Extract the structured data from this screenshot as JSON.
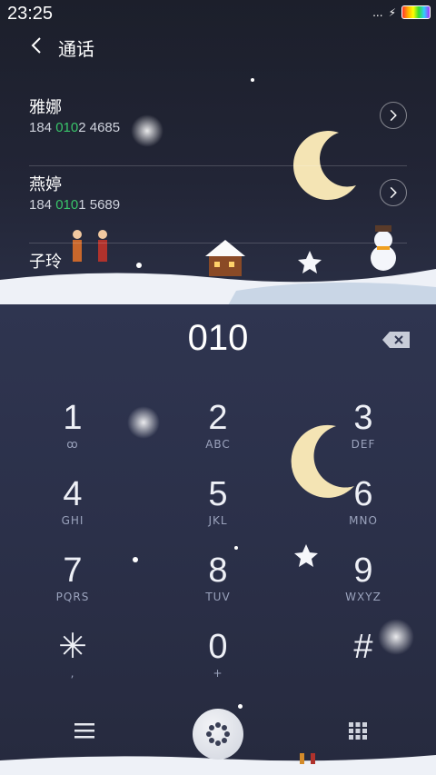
{
  "status": {
    "time": "23:25",
    "signal_dots": "...",
    "charging": "⚡"
  },
  "header": {
    "title": "通话"
  },
  "contacts": [
    {
      "name": "雅娜",
      "num_pre": "184 ",
      "num_hl": "010",
      "num_post": "2 4685"
    },
    {
      "name": "燕婷",
      "num_pre": "184 ",
      "num_hl": "010",
      "num_post": "1 5689"
    },
    {
      "name": "子玲"
    }
  ],
  "dialer": {
    "input": "010"
  },
  "keys": [
    {
      "digit": "1",
      "letters": "ꝏ"
    },
    {
      "digit": "2",
      "letters": "ABC"
    },
    {
      "digit": "3",
      "letters": "DEF"
    },
    {
      "digit": "4",
      "letters": "GHI"
    },
    {
      "digit": "5",
      "letters": "JKL"
    },
    {
      "digit": "6",
      "letters": "MNO"
    },
    {
      "digit": "7",
      "letters": "PQRS"
    },
    {
      "digit": "8",
      "letters": "TUV"
    },
    {
      "digit": "9",
      "letters": "WXYZ"
    },
    {
      "digit": "✳",
      "letters": ","
    },
    {
      "digit": "0",
      "letters": "+"
    },
    {
      "digit": "#",
      "letters": ""
    }
  ],
  "colors": {
    "highlight": "#39c46a",
    "pad_bg": "#2b3049"
  }
}
